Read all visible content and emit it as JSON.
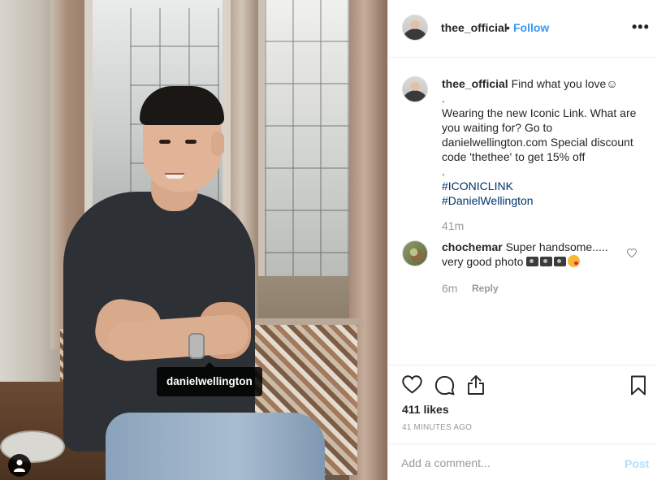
{
  "photo": {
    "brand_tag": "danielwellington"
  },
  "header": {
    "username": "thee_official",
    "separator": "•",
    "follow_label": "Follow",
    "more_label": "•••"
  },
  "caption": {
    "username": "thee_official",
    "lines": [
      "Find what you love☺",
      ".",
      "Wearing the new Iconic Link. What are",
      "you waiting for? Go to",
      "danielwellington.com Special discount",
      "code 'thethee' to get 15% off",
      "."
    ],
    "hashtags": [
      "#ICONICLINK",
      "#DanielWellington"
    ],
    "time": "41m"
  },
  "comment": {
    "username": "chochemar",
    "text_line1": "Super handsome.....",
    "text_line2": "very good photo",
    "emojis": [
      "camera-icon",
      "camera-icon",
      "camera-icon",
      "kissing-face-icon"
    ],
    "time": "6m",
    "reply_label": "Reply"
  },
  "actions": {
    "likes": "411 likes",
    "posted_ago": "41 MINUTES AGO",
    "icons": [
      "heart-icon",
      "comment-icon",
      "share-icon",
      "bookmark-icon"
    ]
  },
  "add_comment": {
    "placeholder": "Add a comment...",
    "post_label": "Post"
  },
  "colors": {
    "accent": "#3897f0",
    "hashtag": "#003569",
    "post_disabled": "#b2dffc",
    "muted": "#999999"
  }
}
